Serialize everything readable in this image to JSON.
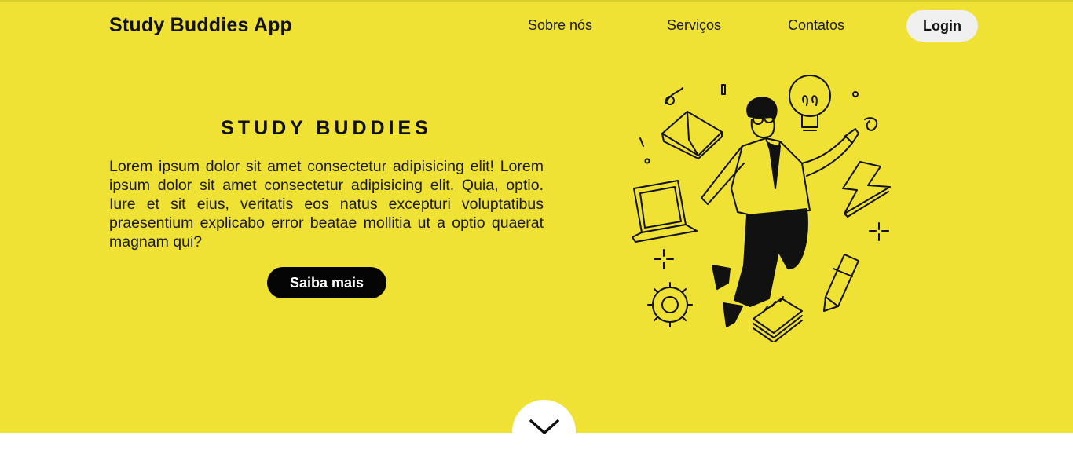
{
  "header": {
    "brand": "Study Buddies App",
    "nav": [
      "Sobre nós",
      "Serviços",
      "Contatos"
    ],
    "login_label": "Login"
  },
  "hero": {
    "title": "STUDY BUDDIES",
    "text": "Lorem ipsum dolor sit amet consectetur adipisicing elit! Lorem ipsum dolor sit amet consectetur adipisicing elit. Quia, optio. Iure et sit eius, veritatis eos natus excepturi voluptatibus praesentium explicabo error beatae mollitia ut a optio quaerat magnam qui?",
    "cta_label": "Saiba mais",
    "illustration_icon": "student-flying-with-study-items-illustration"
  },
  "scroll": {
    "icon": "chevron-down-icon"
  },
  "colors": {
    "hero_background": "#f0e234",
    "cta_background": "#050505",
    "login_background": "#f0f0f0"
  }
}
